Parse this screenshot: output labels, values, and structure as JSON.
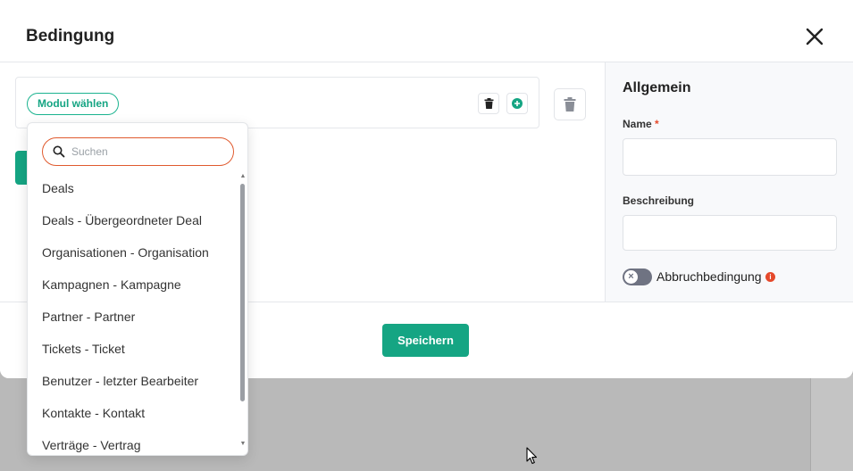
{
  "modal": {
    "title": "Bedingung"
  },
  "condition": {
    "module_button": "Modul wählen"
  },
  "dropdown": {
    "search_placeholder": "Suchen",
    "items": [
      "Deals",
      "Deals - Übergeordneter Deal",
      "Organisationen - Organisation",
      "Kampagnen - Kampagne",
      "Partner - Partner",
      "Tickets - Ticket",
      "Benutzer - letzter Bearbeiter",
      "Kontakte - Kontakt",
      "Verträge - Vertrag"
    ]
  },
  "sidebar": {
    "title": "Allgemein",
    "name_label": "Name",
    "required_marker": "*",
    "description_label": "Beschreibung",
    "abort_label": "Abbruchbedingung",
    "abort_enabled": false
  },
  "footer": {
    "save_label": "Speichern"
  },
  "colors": {
    "accent": "#15a583",
    "danger": "#e5492b"
  }
}
